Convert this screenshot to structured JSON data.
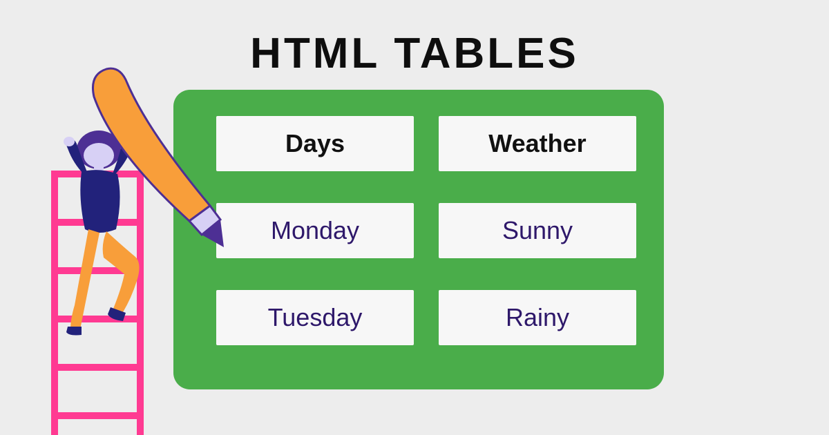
{
  "title": "HTML TABLES",
  "table": {
    "headers": [
      "Days",
      "Weather"
    ],
    "rows": [
      [
        "Monday",
        "Sunny"
      ],
      [
        "Tuesday",
        "Rainy"
      ]
    ]
  },
  "colors": {
    "tableBg": "#4aad4a",
    "cellBg": "#f7f7f7",
    "textPurple": "#2e186a",
    "ladder": "#ff3a92",
    "pencilOrange": "#f89e3a",
    "personNavy": "#22227b",
    "skinLilac": "#d7d0f5"
  }
}
